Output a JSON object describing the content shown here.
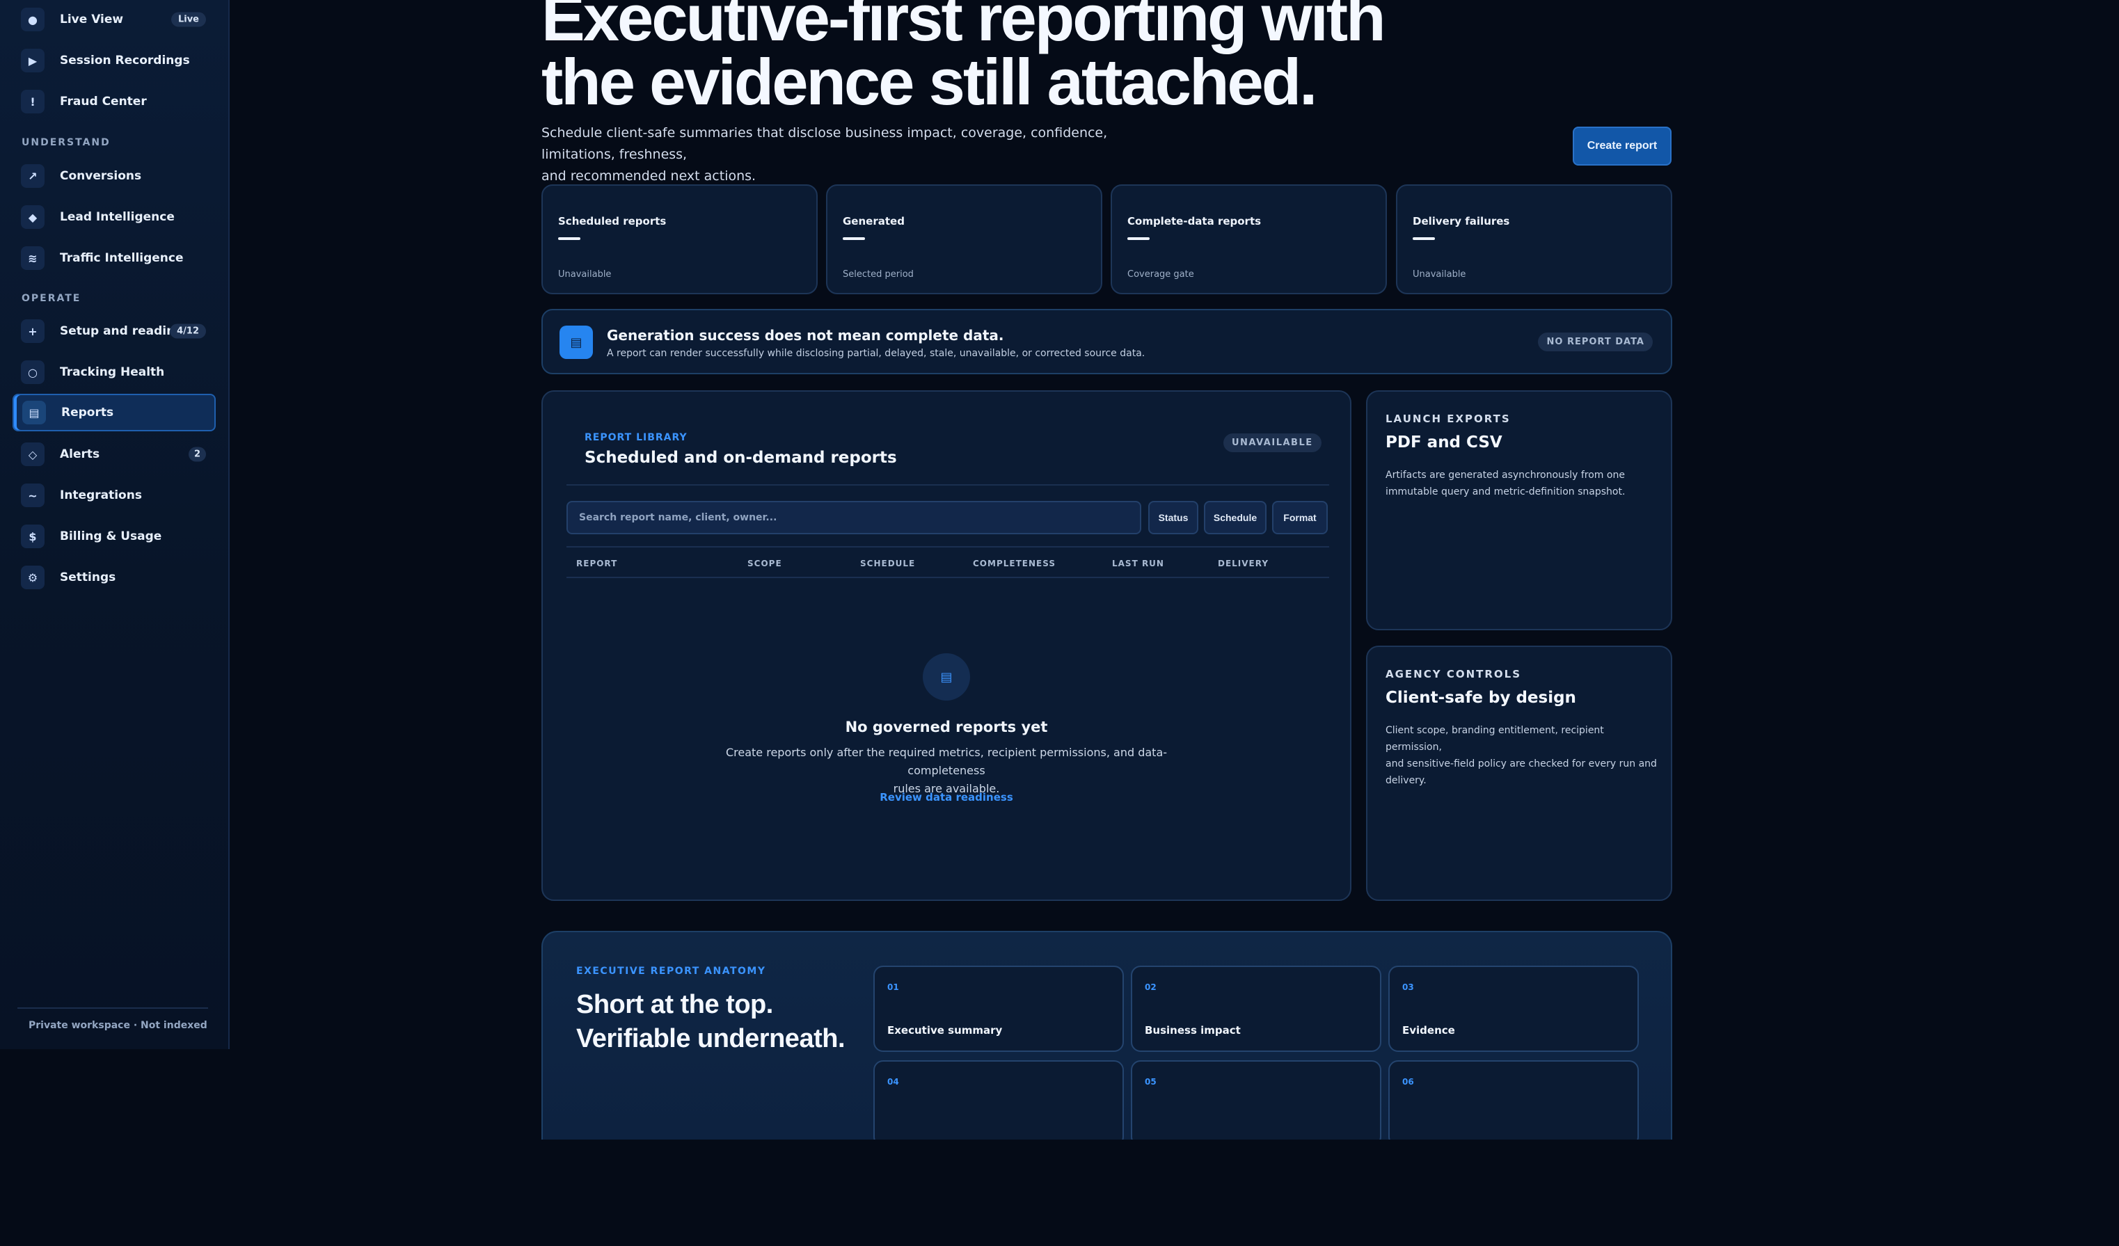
{
  "sidebar": {
    "items_top": [
      {
        "label": "Live View",
        "icon": "dot-icon",
        "glyph": "●",
        "badge": "Live"
      },
      {
        "label": "Session Recordings",
        "icon": "play-icon",
        "glyph": "▶"
      },
      {
        "label": "Fraud Center",
        "icon": "exclamation-icon",
        "glyph": "!"
      }
    ],
    "section_understand": "UNDERSTAND",
    "items_understand": [
      {
        "label": "Conversions",
        "icon": "trend-arrow-icon",
        "glyph": "↗"
      },
      {
        "label": "Lead Intelligence",
        "icon": "diamond-icon",
        "glyph": "◆"
      },
      {
        "label": "Traffic Intelligence",
        "icon": "waves-icon",
        "glyph": "≋"
      }
    ],
    "section_operate": "OPERATE",
    "items_operate": [
      {
        "label": "Setup and readiness",
        "icon": "plus-icon",
        "glyph": "+",
        "badge": "4/12"
      },
      {
        "label": "Tracking Health",
        "icon": "ring-icon",
        "glyph": "○"
      },
      {
        "label": "Reports",
        "icon": "report-icon",
        "glyph": "▤",
        "active": true
      },
      {
        "label": "Alerts",
        "icon": "alert-diamond-icon",
        "glyph": "◇",
        "badge": "2"
      },
      {
        "label": "Integrations",
        "icon": "tilde-icon",
        "glyph": "~"
      },
      {
        "label": "Billing & Usage",
        "icon": "dollar-icon",
        "glyph": "$"
      },
      {
        "label": "Settings",
        "icon": "gear-icon",
        "glyph": "⚙"
      }
    ],
    "footer": "Private workspace · Not indexed"
  },
  "hero": {
    "title_line1": "Executive-first reporting with",
    "title_line2": "the evidence still attached.",
    "subtitle_line1": "Schedule client-safe summaries that disclose business impact, coverage, confidence, limitations, freshness,",
    "subtitle_line2": "and recommended next actions.",
    "create_button": "Create report"
  },
  "stats": [
    {
      "label": "Scheduled reports",
      "value": "—",
      "foot": "Unavailable"
    },
    {
      "label": "Generated",
      "value": "—",
      "foot": "Selected period"
    },
    {
      "label": "Complete-data reports",
      "value": "—",
      "foot": "Coverage gate"
    },
    {
      "label": "Delivery failures",
      "value": "—",
      "foot": "Unavailable"
    }
  ],
  "notice": {
    "icon_glyph": "▤",
    "title": "Generation success does not mean complete data.",
    "text": "A report can render successfully while disclosing partial, delayed, stale, unavailable, or corrected source data.",
    "badge": "NO REPORT DATA"
  },
  "library": {
    "eyebrow": "REPORT LIBRARY",
    "title": "Scheduled and on-demand reports",
    "badge": "UNAVAILABLE",
    "search_placeholder": "Search report name, client, owner...",
    "filters": [
      "Status",
      "Schedule",
      "Format"
    ],
    "columns": [
      "REPORT",
      "SCOPE",
      "SCHEDULE",
      "COMPLETENESS",
      "LAST RUN",
      "DELIVERY"
    ],
    "empty": {
      "icon_glyph": "▤",
      "title": "No governed reports yet",
      "text_line1": "Create reports only after the required metrics, recipient permissions, and data-completeness",
      "text_line2": "rules are available.",
      "link": "Review data readiness"
    }
  },
  "exports_card": {
    "eyebrow": "LAUNCH EXPORTS",
    "title": "PDF and CSV",
    "text_line1": "Artifacts are generated asynchronously from one",
    "text_line2": "immutable query and metric-definition snapshot."
  },
  "agency_card": {
    "eyebrow": "AGENCY CONTROLS",
    "title": "Client-safe by design",
    "text_line1": "Client scope, branding entitlement, recipient permission,",
    "text_line2": "and sensitive-field policy are checked for every run and",
    "text_line3": "delivery."
  },
  "anatomy": {
    "eyebrow": "EXECUTIVE REPORT ANATOMY",
    "title_line1": "Short at the top.",
    "title_line2": "Verifiable underneath.",
    "cards": [
      {
        "num": "01",
        "label": "Executive summary"
      },
      {
        "num": "02",
        "label": "Business impact"
      },
      {
        "num": "03",
        "label": "Evidence"
      },
      {
        "num": "04",
        "label": ""
      },
      {
        "num": "05",
        "label": ""
      },
      {
        "num": "06",
        "label": ""
      }
    ]
  },
  "colors": {
    "background": "#050b17",
    "sidebar": "#0b1c36",
    "card": "#0b1b33",
    "accent": "#3b94ff",
    "primary_button": "#1257a8"
  }
}
